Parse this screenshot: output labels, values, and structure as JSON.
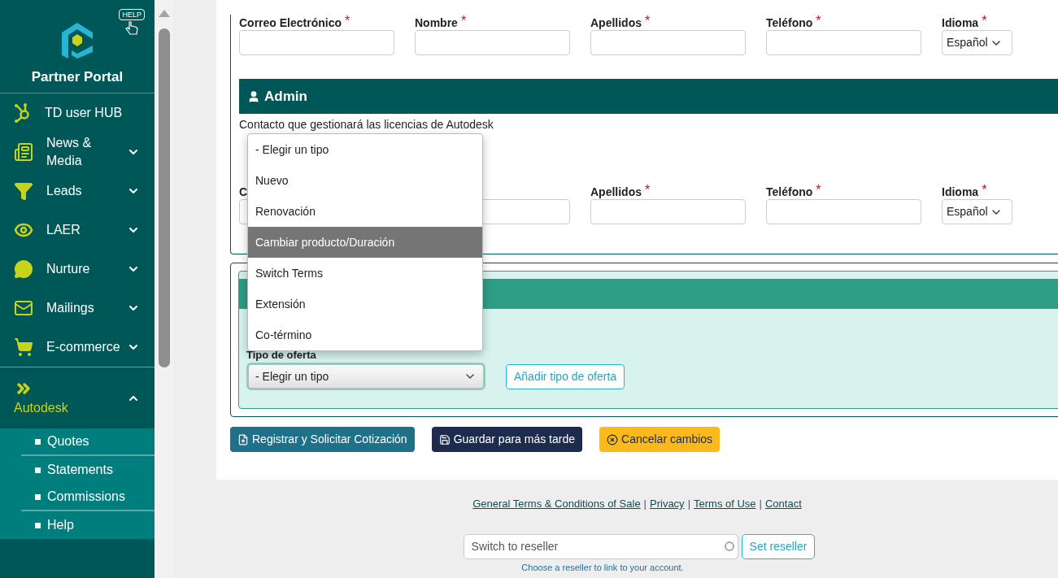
{
  "sidebar": {
    "help_badge": "HELP",
    "logo_text": "Partner Portal",
    "items": [
      {
        "label": "TD user HUB",
        "kind": "link",
        "selected": false
      },
      {
        "label": "News & Media",
        "kind": "menu",
        "expanded": false,
        "selected": false
      },
      {
        "label": "Leads",
        "kind": "menu",
        "expanded": false,
        "selected": false
      },
      {
        "label": "LAER",
        "kind": "menu",
        "expanded": false,
        "selected": false
      },
      {
        "label": "Nurture",
        "kind": "menu",
        "expanded": false,
        "selected": false
      },
      {
        "label": "Mailings",
        "kind": "menu",
        "expanded": false,
        "selected": false
      },
      {
        "label": "E-commerce",
        "kind": "menu",
        "expanded": false,
        "selected": false
      },
      {
        "label": "Autodesk",
        "kind": "menu",
        "expanded": true,
        "selected": true,
        "children": [
          {
            "label": "Quotes"
          },
          {
            "label": "Statements"
          },
          {
            "label": "Commissions"
          },
          {
            "label": "Help"
          }
        ]
      }
    ]
  },
  "contact": {
    "fields": [
      {
        "label": "Correo Electrónico",
        "required_mark": "*",
        "kind": "text"
      },
      {
        "label": "Nombre",
        "required_mark": "*",
        "kind": "text"
      },
      {
        "label": "Apellidos",
        "required_mark": "*",
        "kind": "text"
      },
      {
        "label": "Teléfono",
        "required_mark": "*",
        "kind": "text"
      },
      {
        "label": "Idioma",
        "required_mark": "*",
        "kind": "select",
        "value": "Español"
      }
    ]
  },
  "admin": {
    "title": "Admin",
    "description": "Contacto que gestionará las licencias de Autodesk",
    "fields": [
      {
        "label": "C",
        "kind": "text"
      },
      {
        "kind": "text"
      },
      {
        "label": "Apellidos",
        "required_mark": "*",
        "kind": "text"
      },
      {
        "label": "Teléfono",
        "required_mark": "*",
        "kind": "text"
      },
      {
        "label": "Idioma",
        "required_mark": "*",
        "kind": "select",
        "value": "Español"
      }
    ]
  },
  "offer": {
    "label": "Tipo de oferta",
    "select_value": "- Elegir un tipo",
    "add_button": "Añadir tipo de oferta"
  },
  "dropdown": {
    "options": [
      {
        "label": "- Elegir un tipo",
        "selected": false
      },
      {
        "label": "Nuevo",
        "selected": false
      },
      {
        "label": "Renovación",
        "selected": false
      },
      {
        "label": "Cambiar producto/Duración",
        "selected": true
      },
      {
        "label": "Switch Terms",
        "selected": false
      },
      {
        "label": "Extensión",
        "selected": false
      },
      {
        "label": "Co-término",
        "selected": false
      }
    ]
  },
  "actions": [
    {
      "label": "Registrar y Solicitar Cotización",
      "kind": "submit"
    },
    {
      "label": "Guardar para más tarde",
      "kind": "save"
    },
    {
      "label": "Cancelar cambios",
      "kind": "cancel"
    }
  ],
  "footer": {
    "separator": "|",
    "links": [
      "General Terms & Conditions of Sale",
      "Privacy",
      "Terms of Use",
      "Contact"
    ],
    "reseller": {
      "placeholder": "Switch to reseller",
      "button": "Set reseller",
      "hint": "Choose a reseller to link to your account."
    }
  }
}
